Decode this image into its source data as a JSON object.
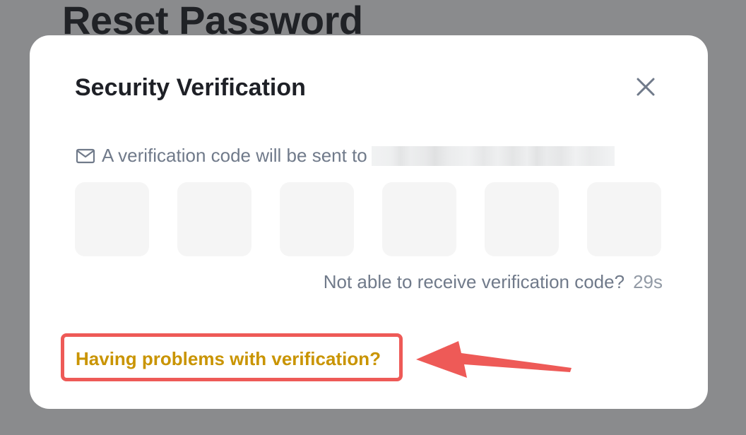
{
  "background": {
    "title": "Reset Password"
  },
  "modal": {
    "title": "Security Verification",
    "close_icon": "close-icon",
    "sent_message": "A verification code will be sent to",
    "mail_icon": "mail-icon",
    "code_inputs": [
      "",
      "",
      "",
      "",
      "",
      ""
    ],
    "resend_prompt": "Not able to receive verification code?",
    "countdown": "29s",
    "help_link": "Having problems with verification?"
  },
  "annotation": {
    "highlight_color": "#ee5a57",
    "link_color": "#c99400"
  }
}
